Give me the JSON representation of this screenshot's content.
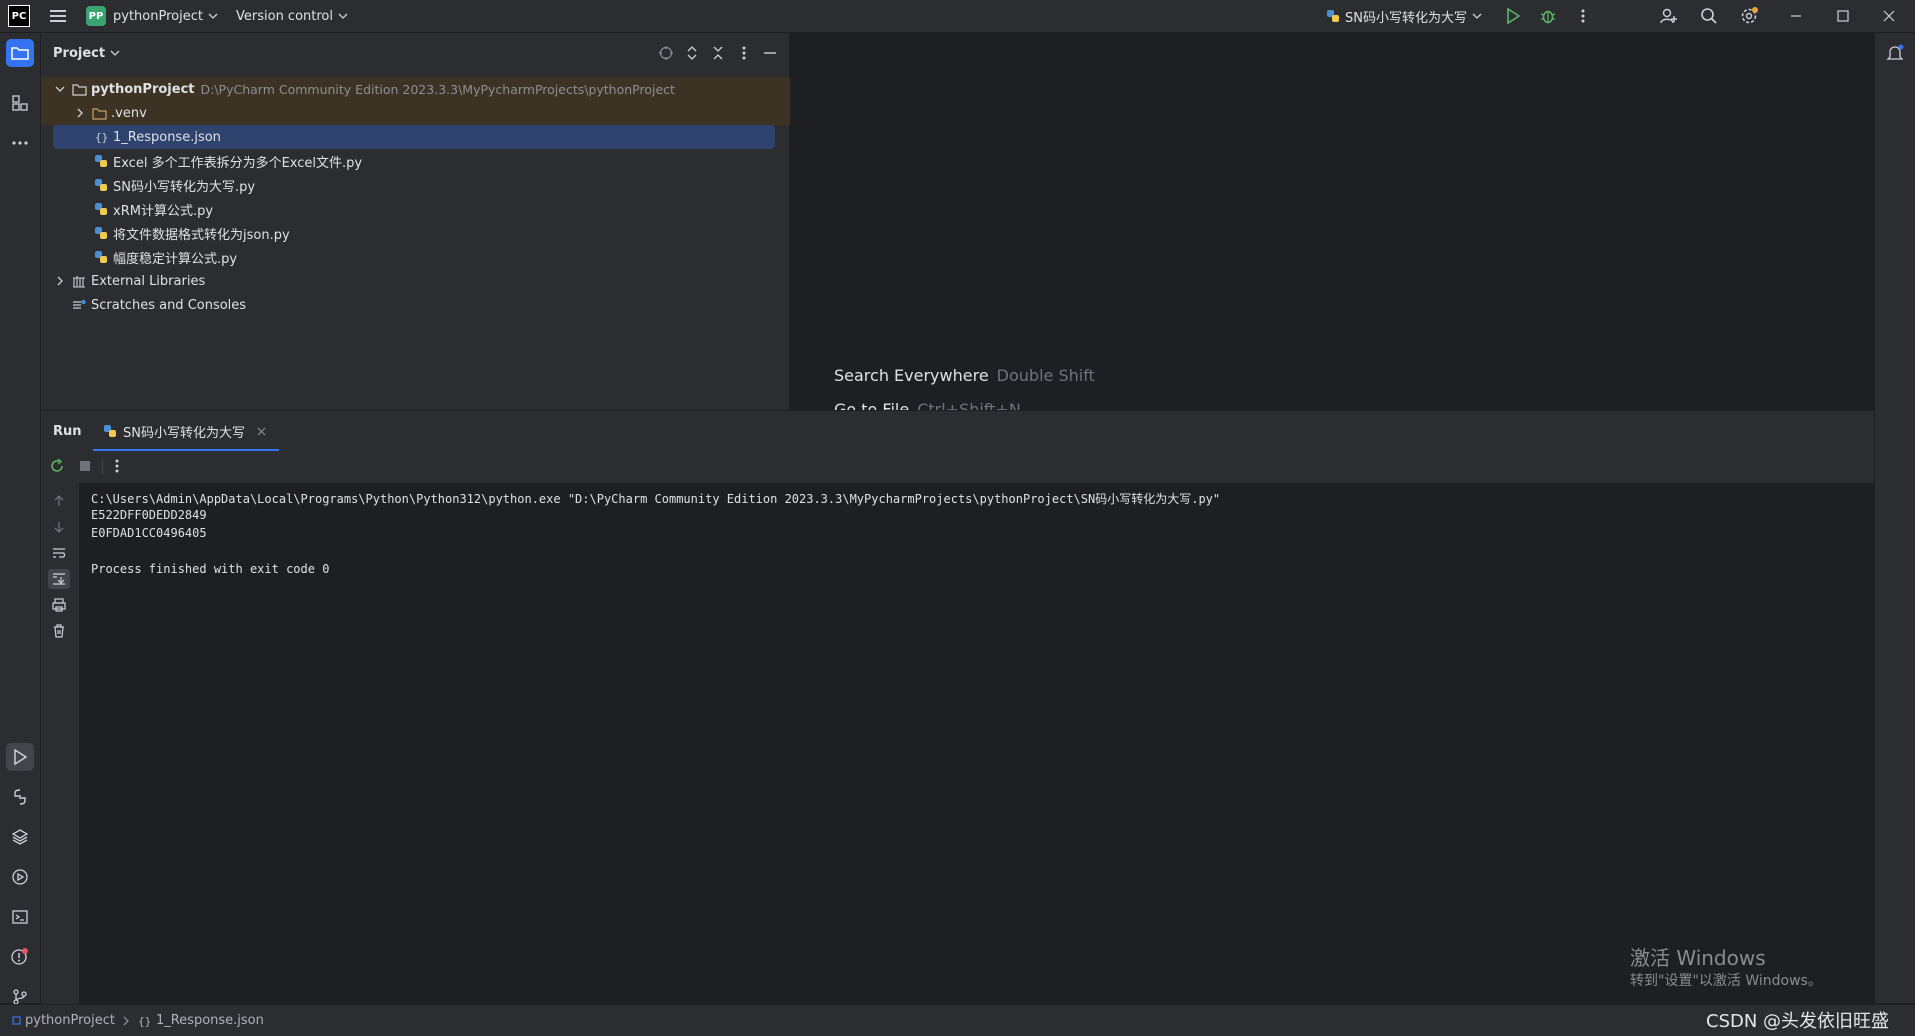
{
  "titlebar": {
    "logo": "PC",
    "project_badge": "PP",
    "project_name": "pythonProject",
    "vcs_label": "Version control",
    "run_config": "SN码小写转化为大写"
  },
  "project_panel": {
    "title": "Project",
    "root_name": "pythonProject",
    "root_path": "D:\\PyCharm Community Edition 2023.3.3\\MyPycharmProjects\\pythonProject",
    "items": [
      {
        "label": ".venv",
        "kind": "folder"
      },
      {
        "label": "1_Response.json",
        "kind": "json"
      },
      {
        "label": "Excel 多个工作表拆分为多个Excel文件.py",
        "kind": "py"
      },
      {
        "label": "SN码小写转化为大写.py",
        "kind": "py"
      },
      {
        "label": "xRM计算公式.py",
        "kind": "py"
      },
      {
        "label": "将文件数据格式转化为json.py",
        "kind": "py"
      },
      {
        "label": "幅度稳定计算公式.py",
        "kind": "py"
      }
    ],
    "external_libraries": "External Libraries",
    "scratches": "Scratches and Consoles"
  },
  "editor": {
    "hints": [
      {
        "action": "Search Everywhere",
        "key": "Double Shift"
      },
      {
        "action": "Go to File",
        "key": "Ctrl+Shift+N"
      }
    ]
  },
  "run_panel": {
    "label": "Run",
    "tab_label": "SN码小写转化为大写",
    "console_lines": [
      "C:\\Users\\Admin\\AppData\\Local\\Programs\\Python\\Python312\\python.exe \"D:\\PyCharm Community Edition 2023.3.3\\MyPycharmProjects\\pythonProject\\SN码小写转化为大写.py\"",
      "E522DFF0DEDD2849",
      "E0FDAD1CC0496405",
      "",
      "Process finished with exit code 0"
    ]
  },
  "statusbar": {
    "crumb_project": "pythonProject",
    "crumb_file": "1_Response.json"
  },
  "watermark": {
    "line1": "激活 Windows",
    "line2": "转到\"设置\"以激活 Windows。",
    "csdn": "CSDN @头发依旧旺盛"
  },
  "colors": {
    "accent": "#3574f0",
    "panel_bg": "#2b2d30",
    "editor_bg": "#1e1f22",
    "selection": "#2e436e"
  }
}
